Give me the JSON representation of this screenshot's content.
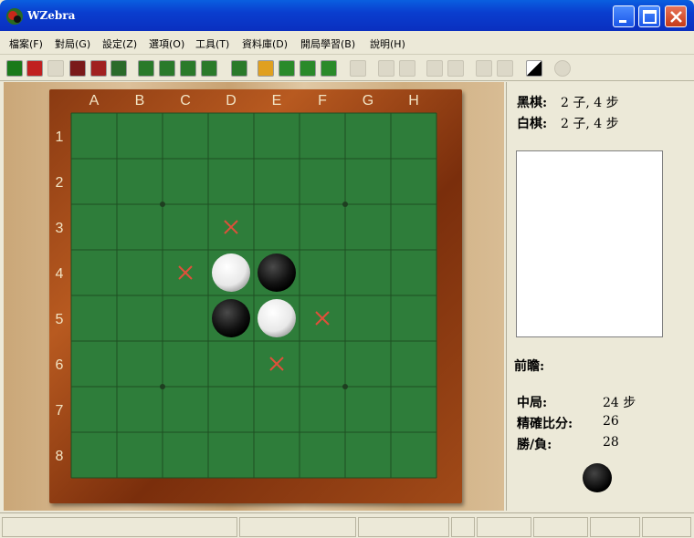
{
  "window": {
    "title": "WZebra"
  },
  "menu": [
    "檔案(F)",
    "對局(G)",
    "設定(Z)",
    "選項(O)",
    "工具(T)",
    "資料庫(D)",
    "開局學習(B)",
    "說明(H)"
  ],
  "board": {
    "columns": [
      "A",
      "B",
      "C",
      "D",
      "E",
      "F",
      "G",
      "H"
    ],
    "rows": [
      "1",
      "2",
      "3",
      "4",
      "5",
      "6",
      "7",
      "8"
    ],
    "discs": [
      {
        "square": "D4",
        "color": "white"
      },
      {
        "square": "E4",
        "color": "black"
      },
      {
        "square": "D5",
        "color": "black"
      },
      {
        "square": "E5",
        "color": "white"
      }
    ],
    "legal_moves": [
      "D3",
      "C4",
      "F5",
      "E6"
    ]
  },
  "panel": {
    "black_label": "黑棋:",
    "black_value": "2 子, 4 步",
    "white_label": "白棋:",
    "white_value": "2 子, 4 步",
    "outlook_label": "前瞻:",
    "midgame_label": "中局:",
    "midgame_value": "24 步",
    "exact_label": "精確比分:",
    "exact_value": "26",
    "winloss_label": "勝/負:",
    "winloss_value": "28",
    "turn_color": "black"
  }
}
